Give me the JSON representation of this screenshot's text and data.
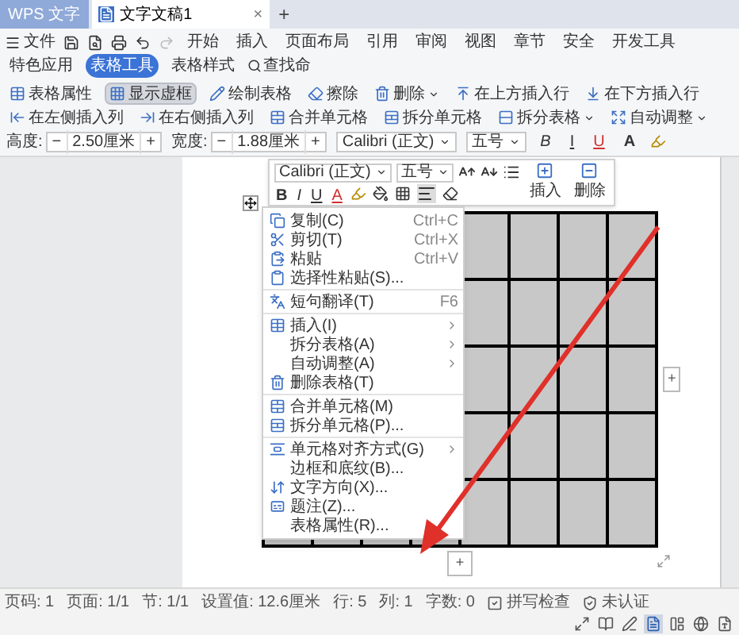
{
  "tabs": [
    {
      "kind": "app",
      "label": "WPS 文字",
      "selected": false
    },
    {
      "kind": "doc",
      "label": "文字文稿1",
      "selected": true,
      "close": "×"
    }
  ],
  "new_tab": "+",
  "menu_bar": {
    "file": "文件",
    "items": [
      {
        "label": "开始",
        "selected": false
      },
      {
        "label": "插入",
        "selected": false
      },
      {
        "label": "页面布局",
        "selected": false
      },
      {
        "label": "引用",
        "selected": false
      },
      {
        "label": "审阅",
        "selected": false
      },
      {
        "label": "视图",
        "selected": false
      },
      {
        "label": "章节",
        "selected": false
      },
      {
        "label": "安全",
        "selected": false
      },
      {
        "label": "开发工具",
        "selected": false
      },
      {
        "label": "特色应用",
        "selected": false
      },
      {
        "label": "表格工具",
        "selected": true
      },
      {
        "label": "表格样式",
        "selected": false
      }
    ],
    "search": "查找命"
  },
  "ribbon": [
    {
      "kind": "button",
      "label": "表格属性",
      "selected": false,
      "dropdown": false
    },
    {
      "kind": "button",
      "label": "显示虚框",
      "selected": true,
      "dropdown": false
    },
    {
      "kind": "button",
      "label": "绘制表格",
      "selected": false,
      "dropdown": false
    },
    {
      "kind": "button",
      "label": "擦除",
      "selected": false,
      "dropdown": false
    },
    {
      "kind": "button",
      "label": "删除",
      "selected": false,
      "dropdown": true
    },
    {
      "kind": "button",
      "label": "在上方插入行",
      "selected": false,
      "dropdown": false
    },
    {
      "kind": "button",
      "label": "在下方插入行",
      "selected": false,
      "dropdown": false
    },
    {
      "kind": "button",
      "label": "在左侧插入列",
      "selected": false,
      "dropdown": false
    },
    {
      "kind": "button",
      "label": "在右侧插入列",
      "selected": false,
      "dropdown": false
    },
    {
      "kind": "button",
      "label": "合并单元格",
      "selected": false,
      "dropdown": false
    },
    {
      "kind": "button",
      "label": "拆分单元格",
      "selected": false,
      "dropdown": false
    },
    {
      "kind": "button",
      "label": "拆分表格",
      "selected": false,
      "dropdown": true
    },
    {
      "kind": "button",
      "label": "自动调整",
      "selected": false,
      "dropdown": true
    },
    {
      "kind": "spin",
      "label": "高度:",
      "value": "2.50厘米",
      "minus": "−",
      "plus": "+"
    },
    {
      "kind": "spin",
      "label": "宽度:",
      "value": "1.88厘米",
      "minus": "−",
      "plus": "+"
    },
    {
      "kind": "select",
      "value": "Calibri (正文)"
    },
    {
      "kind": "select",
      "value": "五号"
    },
    {
      "kind": "format",
      "label": "B"
    },
    {
      "kind": "format",
      "label": "I"
    },
    {
      "kind": "format",
      "label": "U"
    },
    {
      "kind": "format",
      "label": "A"
    }
  ],
  "mini_toolbar": {
    "font": "Calibri (正文)",
    "size": "五号",
    "formats": [
      "B",
      "I",
      "U",
      "A"
    ],
    "buttons": [
      "插入",
      "删除"
    ]
  },
  "context_menu": [
    {
      "kind": "item",
      "label": "复制(C)",
      "shortcut": "Ctrl+C",
      "submenu": false
    },
    {
      "kind": "item",
      "label": "剪切(T)",
      "shortcut": "Ctrl+X",
      "submenu": false
    },
    {
      "kind": "item",
      "label": "粘贴",
      "shortcut": "Ctrl+V",
      "submenu": false
    },
    {
      "kind": "item",
      "label": "选择性粘贴(S)...",
      "submenu": false
    },
    {
      "kind": "separator"
    },
    {
      "kind": "item",
      "label": "短句翻译(T)",
      "shortcut": "F6",
      "submenu": false
    },
    {
      "kind": "separator"
    },
    {
      "kind": "item",
      "label": "插入(I)",
      "submenu": true
    },
    {
      "kind": "item",
      "label": "拆分表格(A)",
      "submenu": true
    },
    {
      "kind": "item",
      "label": "自动调整(A)",
      "submenu": true
    },
    {
      "kind": "item",
      "label": "删除表格(T)",
      "submenu": false
    },
    {
      "kind": "separator"
    },
    {
      "kind": "item",
      "label": "合并单元格(M)",
      "submenu": false
    },
    {
      "kind": "item",
      "label": "拆分单元格(P)...",
      "submenu": false
    },
    {
      "kind": "separator"
    },
    {
      "kind": "item",
      "label": "单元格对齐方式(G)",
      "submenu": true
    },
    {
      "kind": "item",
      "label": "边框和底纹(B)...",
      "submenu": false
    },
    {
      "kind": "item",
      "label": "文字方向(X)...",
      "submenu": false
    },
    {
      "kind": "item",
      "label": "题注(Z)...",
      "submenu": false
    },
    {
      "kind": "item",
      "label": "表格属性(R)...",
      "submenu": false
    }
  ],
  "table": {
    "selected": true,
    "add_row": "+",
    "add_column": "+"
  },
  "status_bar": {
    "items": [
      "页码: 1",
      "页面: 1/1",
      "节: 1/1",
      "设置值: 12.6厘米",
      "行: 5",
      "列: 1",
      "字数: 0"
    ],
    "spell_check": "拼写检查",
    "certification": "未认证",
    "views": [
      {
        "selected": false
      },
      {
        "selected": false
      },
      {
        "selected": false
      },
      {
        "selected": true
      },
      {
        "selected": false
      },
      {
        "selected": false
      },
      {
        "selected": false
      }
    ]
  }
}
